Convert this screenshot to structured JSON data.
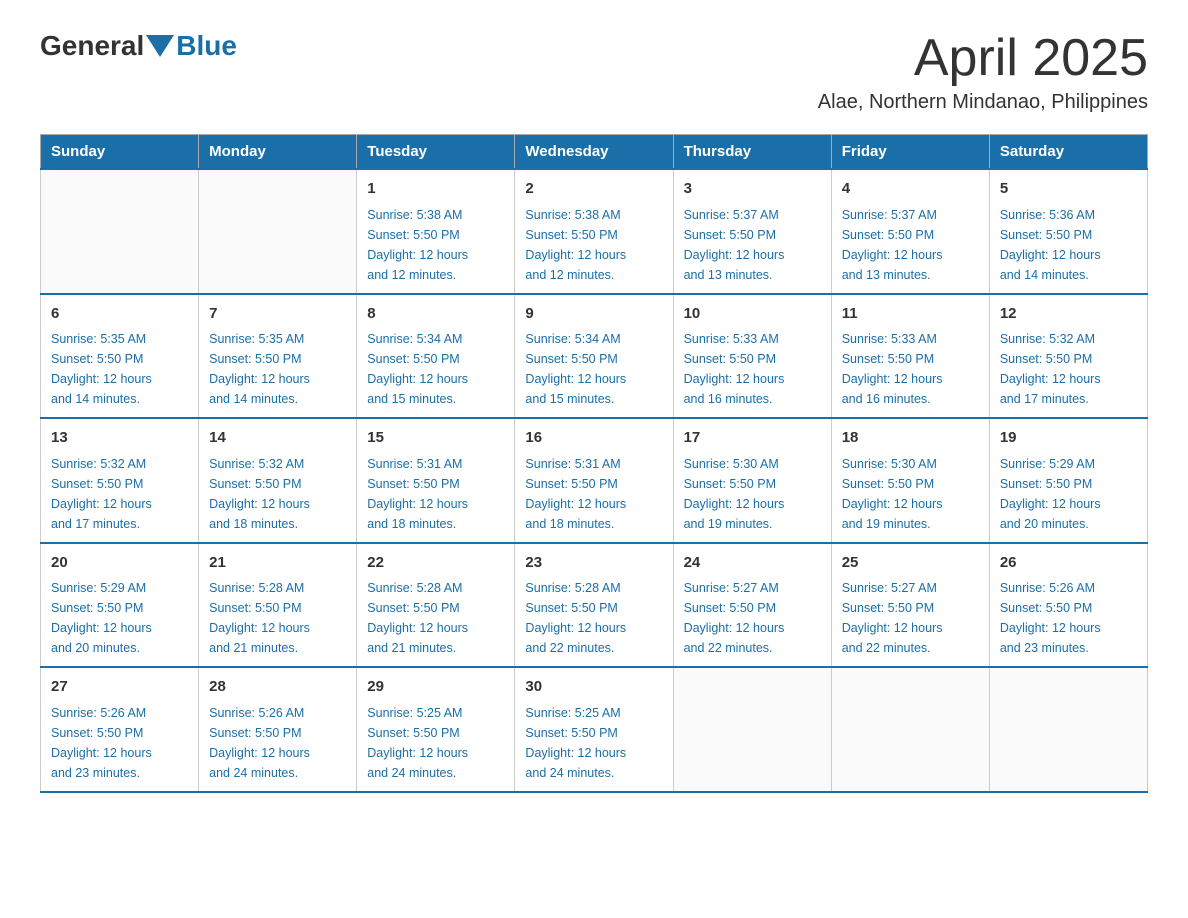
{
  "header": {
    "logo_text_general": "General",
    "logo_text_blue": "Blue",
    "title": "April 2025",
    "location": "Alae, Northern Mindanao, Philippines"
  },
  "days_of_week": [
    "Sunday",
    "Monday",
    "Tuesday",
    "Wednesday",
    "Thursday",
    "Friday",
    "Saturday"
  ],
  "weeks": [
    [
      {
        "day": "",
        "info": ""
      },
      {
        "day": "",
        "info": ""
      },
      {
        "day": "1",
        "info": "Sunrise: 5:38 AM\nSunset: 5:50 PM\nDaylight: 12 hours\nand 12 minutes."
      },
      {
        "day": "2",
        "info": "Sunrise: 5:38 AM\nSunset: 5:50 PM\nDaylight: 12 hours\nand 12 minutes."
      },
      {
        "day": "3",
        "info": "Sunrise: 5:37 AM\nSunset: 5:50 PM\nDaylight: 12 hours\nand 13 minutes."
      },
      {
        "day": "4",
        "info": "Sunrise: 5:37 AM\nSunset: 5:50 PM\nDaylight: 12 hours\nand 13 minutes."
      },
      {
        "day": "5",
        "info": "Sunrise: 5:36 AM\nSunset: 5:50 PM\nDaylight: 12 hours\nand 14 minutes."
      }
    ],
    [
      {
        "day": "6",
        "info": "Sunrise: 5:35 AM\nSunset: 5:50 PM\nDaylight: 12 hours\nand 14 minutes."
      },
      {
        "day": "7",
        "info": "Sunrise: 5:35 AM\nSunset: 5:50 PM\nDaylight: 12 hours\nand 14 minutes."
      },
      {
        "day": "8",
        "info": "Sunrise: 5:34 AM\nSunset: 5:50 PM\nDaylight: 12 hours\nand 15 minutes."
      },
      {
        "day": "9",
        "info": "Sunrise: 5:34 AM\nSunset: 5:50 PM\nDaylight: 12 hours\nand 15 minutes."
      },
      {
        "day": "10",
        "info": "Sunrise: 5:33 AM\nSunset: 5:50 PM\nDaylight: 12 hours\nand 16 minutes."
      },
      {
        "day": "11",
        "info": "Sunrise: 5:33 AM\nSunset: 5:50 PM\nDaylight: 12 hours\nand 16 minutes."
      },
      {
        "day": "12",
        "info": "Sunrise: 5:32 AM\nSunset: 5:50 PM\nDaylight: 12 hours\nand 17 minutes."
      }
    ],
    [
      {
        "day": "13",
        "info": "Sunrise: 5:32 AM\nSunset: 5:50 PM\nDaylight: 12 hours\nand 17 minutes."
      },
      {
        "day": "14",
        "info": "Sunrise: 5:32 AM\nSunset: 5:50 PM\nDaylight: 12 hours\nand 18 minutes."
      },
      {
        "day": "15",
        "info": "Sunrise: 5:31 AM\nSunset: 5:50 PM\nDaylight: 12 hours\nand 18 minutes."
      },
      {
        "day": "16",
        "info": "Sunrise: 5:31 AM\nSunset: 5:50 PM\nDaylight: 12 hours\nand 18 minutes."
      },
      {
        "day": "17",
        "info": "Sunrise: 5:30 AM\nSunset: 5:50 PM\nDaylight: 12 hours\nand 19 minutes."
      },
      {
        "day": "18",
        "info": "Sunrise: 5:30 AM\nSunset: 5:50 PM\nDaylight: 12 hours\nand 19 minutes."
      },
      {
        "day": "19",
        "info": "Sunrise: 5:29 AM\nSunset: 5:50 PM\nDaylight: 12 hours\nand 20 minutes."
      }
    ],
    [
      {
        "day": "20",
        "info": "Sunrise: 5:29 AM\nSunset: 5:50 PM\nDaylight: 12 hours\nand 20 minutes."
      },
      {
        "day": "21",
        "info": "Sunrise: 5:28 AM\nSunset: 5:50 PM\nDaylight: 12 hours\nand 21 minutes."
      },
      {
        "day": "22",
        "info": "Sunrise: 5:28 AM\nSunset: 5:50 PM\nDaylight: 12 hours\nand 21 minutes."
      },
      {
        "day": "23",
        "info": "Sunrise: 5:28 AM\nSunset: 5:50 PM\nDaylight: 12 hours\nand 22 minutes."
      },
      {
        "day": "24",
        "info": "Sunrise: 5:27 AM\nSunset: 5:50 PM\nDaylight: 12 hours\nand 22 minutes."
      },
      {
        "day": "25",
        "info": "Sunrise: 5:27 AM\nSunset: 5:50 PM\nDaylight: 12 hours\nand 22 minutes."
      },
      {
        "day": "26",
        "info": "Sunrise: 5:26 AM\nSunset: 5:50 PM\nDaylight: 12 hours\nand 23 minutes."
      }
    ],
    [
      {
        "day": "27",
        "info": "Sunrise: 5:26 AM\nSunset: 5:50 PM\nDaylight: 12 hours\nand 23 minutes."
      },
      {
        "day": "28",
        "info": "Sunrise: 5:26 AM\nSunset: 5:50 PM\nDaylight: 12 hours\nand 24 minutes."
      },
      {
        "day": "29",
        "info": "Sunrise: 5:25 AM\nSunset: 5:50 PM\nDaylight: 12 hours\nand 24 minutes."
      },
      {
        "day": "30",
        "info": "Sunrise: 5:25 AM\nSunset: 5:50 PM\nDaylight: 12 hours\nand 24 minutes."
      },
      {
        "day": "",
        "info": ""
      },
      {
        "day": "",
        "info": ""
      },
      {
        "day": "",
        "info": ""
      }
    ]
  ],
  "colors": {
    "header_bg": "#1a6fa8",
    "header_text": "#ffffff",
    "accent": "#1a6fa8"
  }
}
